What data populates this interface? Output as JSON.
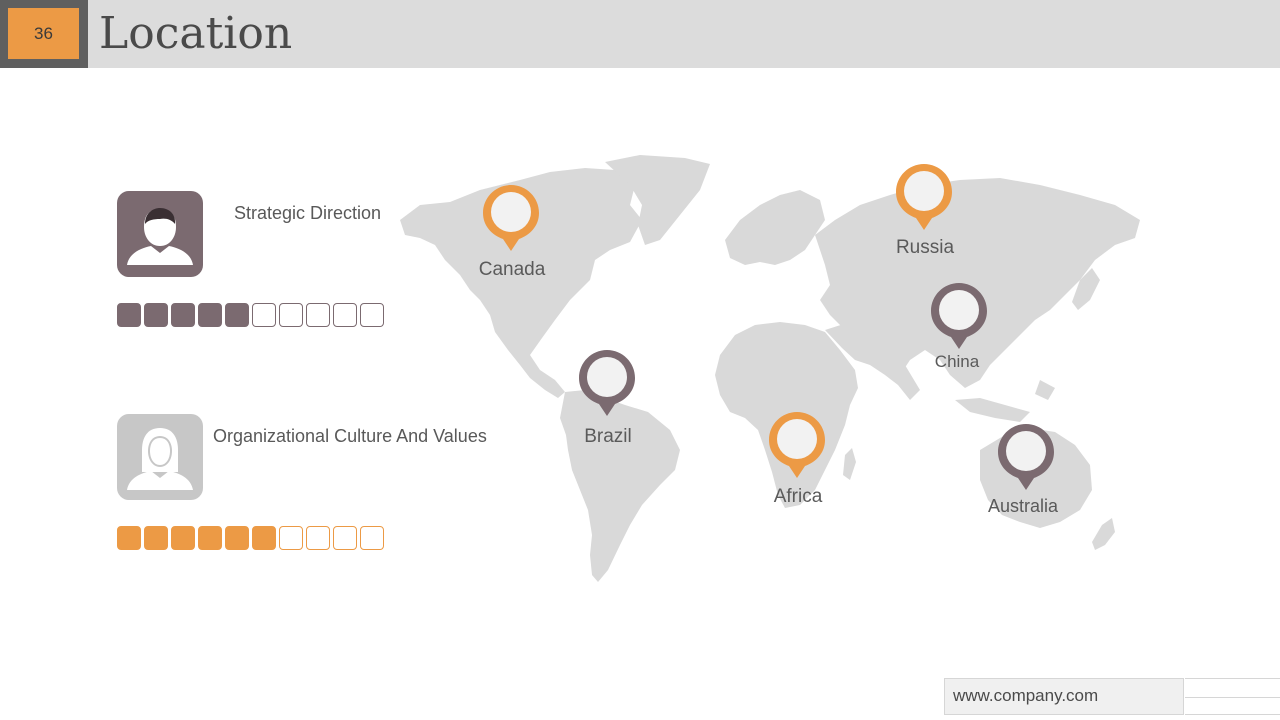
{
  "slide": {
    "number": "36",
    "title": "Location"
  },
  "colors": {
    "orange": "#ec9a45",
    "mauve": "#7b6a70",
    "light_gray": "#c7c7c7",
    "map_gray": "#d9d9d9"
  },
  "profiles": [
    {
      "label": "Strategic Direction",
      "icon": "male-user-icon",
      "meter_filled": 5,
      "meter_total": 10,
      "color": "#7b6a70"
    },
    {
      "label": "Organizational Culture And Values",
      "icon": "female-user-icon",
      "meter_filled": 6,
      "meter_total": 10,
      "color": "#ec9a45"
    }
  ],
  "locations": [
    {
      "name": "Canada",
      "color": "#ec9a45"
    },
    {
      "name": "Russia",
      "color": "#ec9a45"
    },
    {
      "name": "China",
      "color": "#7b6a70"
    },
    {
      "name": "Brazil",
      "color": "#7b6a70"
    },
    {
      "name": "Africa",
      "color": "#ec9a45"
    },
    {
      "name": "Australia",
      "color": "#7b6a70"
    }
  ],
  "footer": {
    "url": "www.company.com"
  }
}
